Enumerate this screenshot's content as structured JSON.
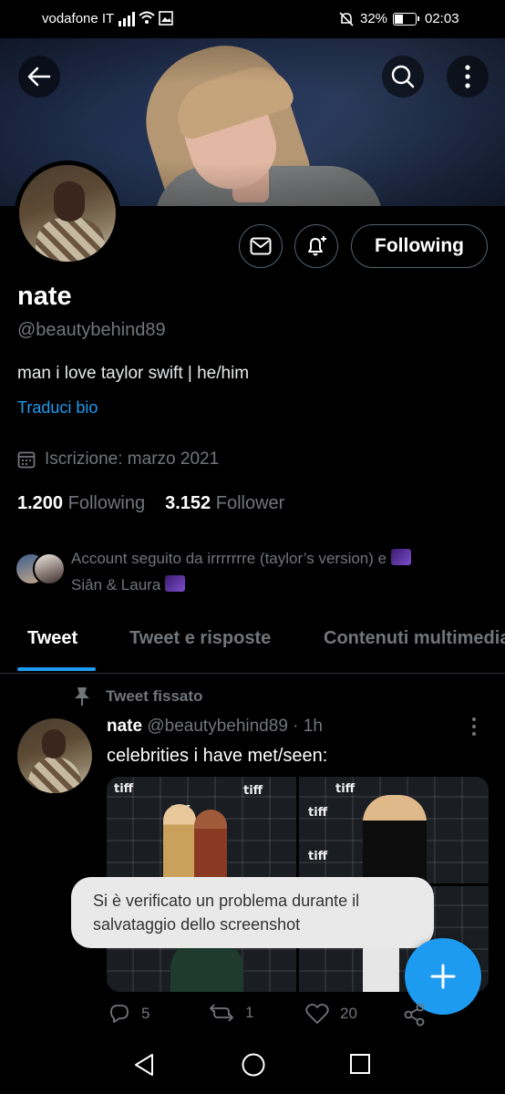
{
  "status_bar": {
    "carrier": "vodafone IT",
    "battery_percent": "32%",
    "time": "02:03"
  },
  "profile": {
    "name": "nate",
    "handle": "@beautybehind89",
    "bio": "man i love taylor swift | he/him",
    "translate_bio": "Traduci bio",
    "joined": "Iscrizione: marzo 2021",
    "following_count": "1.200",
    "following_label": "Following",
    "follower_count": "3.152",
    "follower_label": "Follower",
    "followed_by": "Account seguito da irrrrrrre (taylor’s version) e",
    "followed_by_2": "Siân & Laura",
    "follow_button_label": "Following"
  },
  "tabs": [
    {
      "label": "Tweet",
      "active": true
    },
    {
      "label": "Tweet e risposte",
      "active": false
    },
    {
      "label": "Contenuti multimediali",
      "active": false
    }
  ],
  "tweet": {
    "pinned_label": "Tweet fissato",
    "author_name": "nate",
    "author_handle": "@beautybehind89",
    "time": "· 1h",
    "text": "celebrities i have met/seen:",
    "reply_count": "5",
    "retweet_count": "1",
    "like_count": "20"
  },
  "toast": {
    "message": "Si è verificato un problema durante il salvataggio dello screenshot"
  },
  "colors": {
    "accent": "#1d9bf0",
    "background": "#000000",
    "secondary_text": "#71767b"
  },
  "icons": {
    "back": "arrow-left-icon",
    "search": "search-icon",
    "more": "more-vertical-icon",
    "message": "envelope-icon",
    "notify": "bell-plus-icon",
    "calendar": "calendar-icon",
    "pin": "pin-icon",
    "reply": "reply-icon",
    "retweet": "retweet-icon",
    "like": "heart-icon",
    "share": "share-icon",
    "compose": "plus-icon"
  }
}
